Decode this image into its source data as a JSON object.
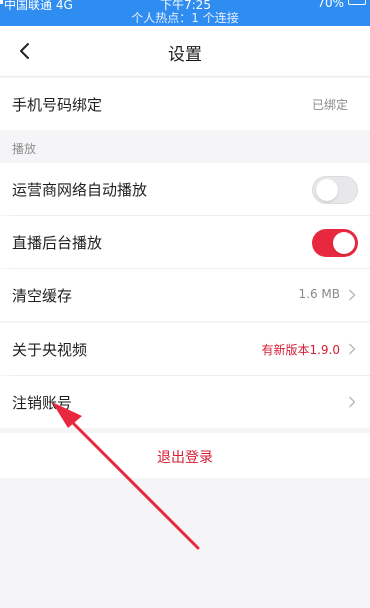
{
  "status_bar": {
    "carrier": "中国联通 4G",
    "time": "下午7:25",
    "battery": "70%",
    "hotspot": "个人热点：1 个连接"
  },
  "nav": {
    "title": "设置",
    "back_icon": "chevron-left-icon"
  },
  "rows": {
    "phone_binding": {
      "label": "手机号码绑定",
      "value": "已绑定"
    },
    "section_playback": "播放",
    "auto_play_cellular": {
      "label": "运营商网络自动播放",
      "toggle_on": false
    },
    "live_background": {
      "label": "直播后台播放",
      "toggle_on": true
    },
    "clear_cache": {
      "label": "清空缓存",
      "value": "1.6 MB"
    },
    "about": {
      "label": "关于央视频",
      "value": "有新版本1.9.0"
    },
    "cancel_account": {
      "label": "注销账号"
    }
  },
  "logout": {
    "label": "退出登录"
  },
  "colors": {
    "status_bar": "#2f8cf0",
    "accent_red": "#e8283f",
    "text_red": "#d61e34",
    "annotation_arrow": "#e8283f"
  },
  "annotation": {
    "icon": "red-arrow-annotation"
  }
}
